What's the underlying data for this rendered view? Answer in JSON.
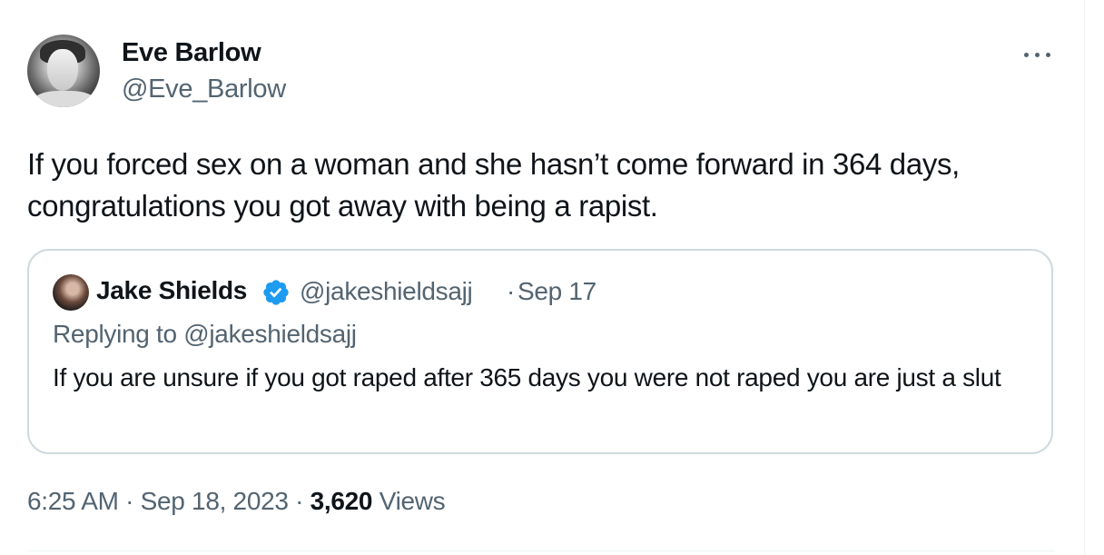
{
  "author": {
    "name": "Eve Barlow",
    "handle": "@Eve_Barlow"
  },
  "tweet": {
    "text": "If you forced sex on a woman and she hasn’t come forward in 364 days, congratulations you got away with being a rapist."
  },
  "quoted": {
    "name": "Jake Shields",
    "handle": "@jakeshieldsajj",
    "separator": "·",
    "date": "Sep 17",
    "replying_to": "Replying to @jakeshieldsajj",
    "text": "If you are unsure if you got raped after 365 days you were not raped you are just a slut",
    "verified": true
  },
  "meta": {
    "time": "6:25 AM",
    "sep1": "·",
    "date": "Sep 18, 2023",
    "sep2": "·",
    "views_count": "3,620",
    "views_label": "Views"
  },
  "icons": {
    "more": "more-horizontal-icon",
    "verified": "verified-badge-icon"
  },
  "colors": {
    "text": "#0f1419",
    "secondary": "#536471",
    "border": "#cfd9de",
    "verified": "#1d9bf0"
  }
}
